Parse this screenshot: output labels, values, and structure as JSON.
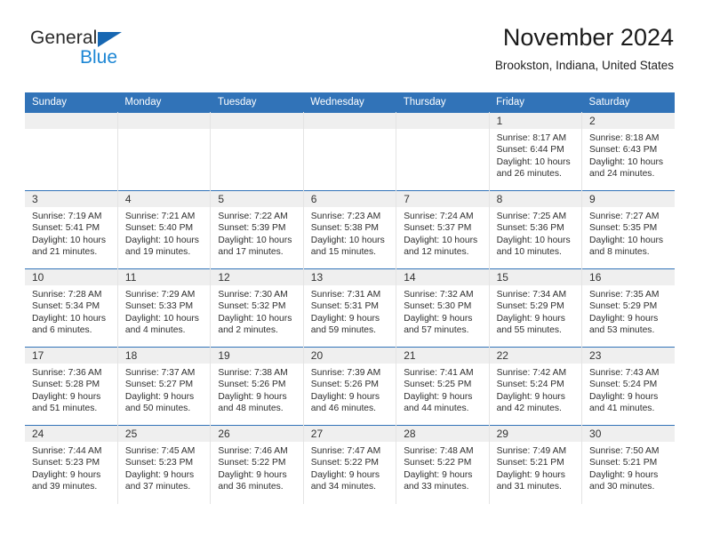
{
  "brand": {
    "name_top": "General",
    "name_bottom": "Blue",
    "triangle_color": "#1767b2",
    "blue_text_color": "#1c86d4"
  },
  "header": {
    "title": "November 2024",
    "location": "Brookston, Indiana, United States"
  },
  "theme": {
    "header_blue": "#3173b8",
    "daynum_band": "#efefef",
    "text": "#2e2e2e"
  },
  "calendar": {
    "weekday_headers": [
      "Sunday",
      "Monday",
      "Tuesday",
      "Wednesday",
      "Thursday",
      "Friday",
      "Saturday"
    ],
    "labels": {
      "sunrise_prefix": "Sunrise:",
      "sunset_prefix": "Sunset:",
      "daylight_prefix": "Daylight:"
    },
    "weeks": [
      [
        {
          "empty": true
        },
        {
          "empty": true
        },
        {
          "empty": true
        },
        {
          "empty": true
        },
        {
          "empty": true
        },
        {
          "day": "1",
          "sunrise": "Sunrise: 8:17 AM",
          "sunset": "Sunset: 6:44 PM",
          "daylight": "Daylight: 10 hours and 26 minutes."
        },
        {
          "day": "2",
          "sunrise": "Sunrise: 8:18 AM",
          "sunset": "Sunset: 6:43 PM",
          "daylight": "Daylight: 10 hours and 24 minutes."
        }
      ],
      [
        {
          "day": "3",
          "sunrise": "Sunrise: 7:19 AM",
          "sunset": "Sunset: 5:41 PM",
          "daylight": "Daylight: 10 hours and 21 minutes."
        },
        {
          "day": "4",
          "sunrise": "Sunrise: 7:21 AM",
          "sunset": "Sunset: 5:40 PM",
          "daylight": "Daylight: 10 hours and 19 minutes."
        },
        {
          "day": "5",
          "sunrise": "Sunrise: 7:22 AM",
          "sunset": "Sunset: 5:39 PM",
          "daylight": "Daylight: 10 hours and 17 minutes."
        },
        {
          "day": "6",
          "sunrise": "Sunrise: 7:23 AM",
          "sunset": "Sunset: 5:38 PM",
          "daylight": "Daylight: 10 hours and 15 minutes."
        },
        {
          "day": "7",
          "sunrise": "Sunrise: 7:24 AM",
          "sunset": "Sunset: 5:37 PM",
          "daylight": "Daylight: 10 hours and 12 minutes."
        },
        {
          "day": "8",
          "sunrise": "Sunrise: 7:25 AM",
          "sunset": "Sunset: 5:36 PM",
          "daylight": "Daylight: 10 hours and 10 minutes."
        },
        {
          "day": "9",
          "sunrise": "Sunrise: 7:27 AM",
          "sunset": "Sunset: 5:35 PM",
          "daylight": "Daylight: 10 hours and 8 minutes."
        }
      ],
      [
        {
          "day": "10",
          "sunrise": "Sunrise: 7:28 AM",
          "sunset": "Sunset: 5:34 PM",
          "daylight": "Daylight: 10 hours and 6 minutes."
        },
        {
          "day": "11",
          "sunrise": "Sunrise: 7:29 AM",
          "sunset": "Sunset: 5:33 PM",
          "daylight": "Daylight: 10 hours and 4 minutes."
        },
        {
          "day": "12",
          "sunrise": "Sunrise: 7:30 AM",
          "sunset": "Sunset: 5:32 PM",
          "daylight": "Daylight: 10 hours and 2 minutes."
        },
        {
          "day": "13",
          "sunrise": "Sunrise: 7:31 AM",
          "sunset": "Sunset: 5:31 PM",
          "daylight": "Daylight: 9 hours and 59 minutes."
        },
        {
          "day": "14",
          "sunrise": "Sunrise: 7:32 AM",
          "sunset": "Sunset: 5:30 PM",
          "daylight": "Daylight: 9 hours and 57 minutes."
        },
        {
          "day": "15",
          "sunrise": "Sunrise: 7:34 AM",
          "sunset": "Sunset: 5:29 PM",
          "daylight": "Daylight: 9 hours and 55 minutes."
        },
        {
          "day": "16",
          "sunrise": "Sunrise: 7:35 AM",
          "sunset": "Sunset: 5:29 PM",
          "daylight": "Daylight: 9 hours and 53 minutes."
        }
      ],
      [
        {
          "day": "17",
          "sunrise": "Sunrise: 7:36 AM",
          "sunset": "Sunset: 5:28 PM",
          "daylight": "Daylight: 9 hours and 51 minutes."
        },
        {
          "day": "18",
          "sunrise": "Sunrise: 7:37 AM",
          "sunset": "Sunset: 5:27 PM",
          "daylight": "Daylight: 9 hours and 50 minutes."
        },
        {
          "day": "19",
          "sunrise": "Sunrise: 7:38 AM",
          "sunset": "Sunset: 5:26 PM",
          "daylight": "Daylight: 9 hours and 48 minutes."
        },
        {
          "day": "20",
          "sunrise": "Sunrise: 7:39 AM",
          "sunset": "Sunset: 5:26 PM",
          "daylight": "Daylight: 9 hours and 46 minutes."
        },
        {
          "day": "21",
          "sunrise": "Sunrise: 7:41 AM",
          "sunset": "Sunset: 5:25 PM",
          "daylight": "Daylight: 9 hours and 44 minutes."
        },
        {
          "day": "22",
          "sunrise": "Sunrise: 7:42 AM",
          "sunset": "Sunset: 5:24 PM",
          "daylight": "Daylight: 9 hours and 42 minutes."
        },
        {
          "day": "23",
          "sunrise": "Sunrise: 7:43 AM",
          "sunset": "Sunset: 5:24 PM",
          "daylight": "Daylight: 9 hours and 41 minutes."
        }
      ],
      [
        {
          "day": "24",
          "sunrise": "Sunrise: 7:44 AM",
          "sunset": "Sunset: 5:23 PM",
          "daylight": "Daylight: 9 hours and 39 minutes."
        },
        {
          "day": "25",
          "sunrise": "Sunrise: 7:45 AM",
          "sunset": "Sunset: 5:23 PM",
          "daylight": "Daylight: 9 hours and 37 minutes."
        },
        {
          "day": "26",
          "sunrise": "Sunrise: 7:46 AM",
          "sunset": "Sunset: 5:22 PM",
          "daylight": "Daylight: 9 hours and 36 minutes."
        },
        {
          "day": "27",
          "sunrise": "Sunrise: 7:47 AM",
          "sunset": "Sunset: 5:22 PM",
          "daylight": "Daylight: 9 hours and 34 minutes."
        },
        {
          "day": "28",
          "sunrise": "Sunrise: 7:48 AM",
          "sunset": "Sunset: 5:22 PM",
          "daylight": "Daylight: 9 hours and 33 minutes."
        },
        {
          "day": "29",
          "sunrise": "Sunrise: 7:49 AM",
          "sunset": "Sunset: 5:21 PM",
          "daylight": "Daylight: 9 hours and 31 minutes."
        },
        {
          "day": "30",
          "sunrise": "Sunrise: 7:50 AM",
          "sunset": "Sunset: 5:21 PM",
          "daylight": "Daylight: 9 hours and 30 minutes."
        }
      ]
    ]
  }
}
